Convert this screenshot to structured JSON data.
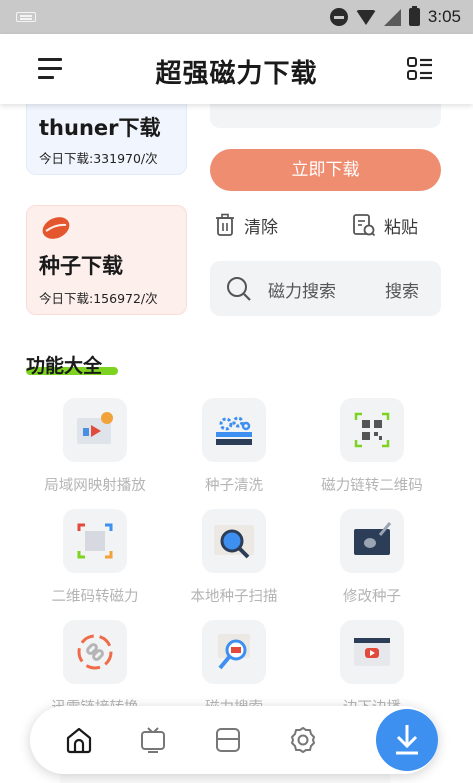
{
  "status_bar": {
    "time": "3:05"
  },
  "app_bar": {
    "title": "超强磁力下载"
  },
  "thunder_card": {
    "title": "thuner下载",
    "stat": "今日下载:331970/次"
  },
  "seed_card": {
    "title": "种子下载",
    "stat": "今日下载:156972/次"
  },
  "download_button": {
    "label": "立即下载"
  },
  "actions": {
    "clear": "清除",
    "paste": "粘贴"
  },
  "search": {
    "placeholder": "磁力搜索",
    "button": "搜索"
  },
  "features_section": {
    "title": "功能大全",
    "items": [
      {
        "label": "局域网映射播放",
        "icon": "tv-cast-icon"
      },
      {
        "label": "种子清洗",
        "icon": "gears-icon"
      },
      {
        "label": "磁力链转二维码",
        "icon": "qr-code-icon"
      },
      {
        "label": "二维码转磁力",
        "icon": "qr-scan-icon"
      },
      {
        "label": "本地种子扫描",
        "icon": "magnifier-seed-icon"
      },
      {
        "label": "修改种子",
        "icon": "edit-seed-icon"
      },
      {
        "label": "迅雷链接转换",
        "icon": "link-convert-icon"
      },
      {
        "label": "磁力搜索",
        "icon": "job-search-icon"
      },
      {
        "label": "边下边播",
        "icon": "play-video-icon"
      }
    ]
  },
  "bottom_nav": {
    "items": [
      "home-icon",
      "tv-icon",
      "folder-icon",
      "settings-icon",
      "download-icon"
    ],
    "colors": {
      "accent": "#3d8ff0",
      "primary_button": "#ef8d71"
    }
  }
}
